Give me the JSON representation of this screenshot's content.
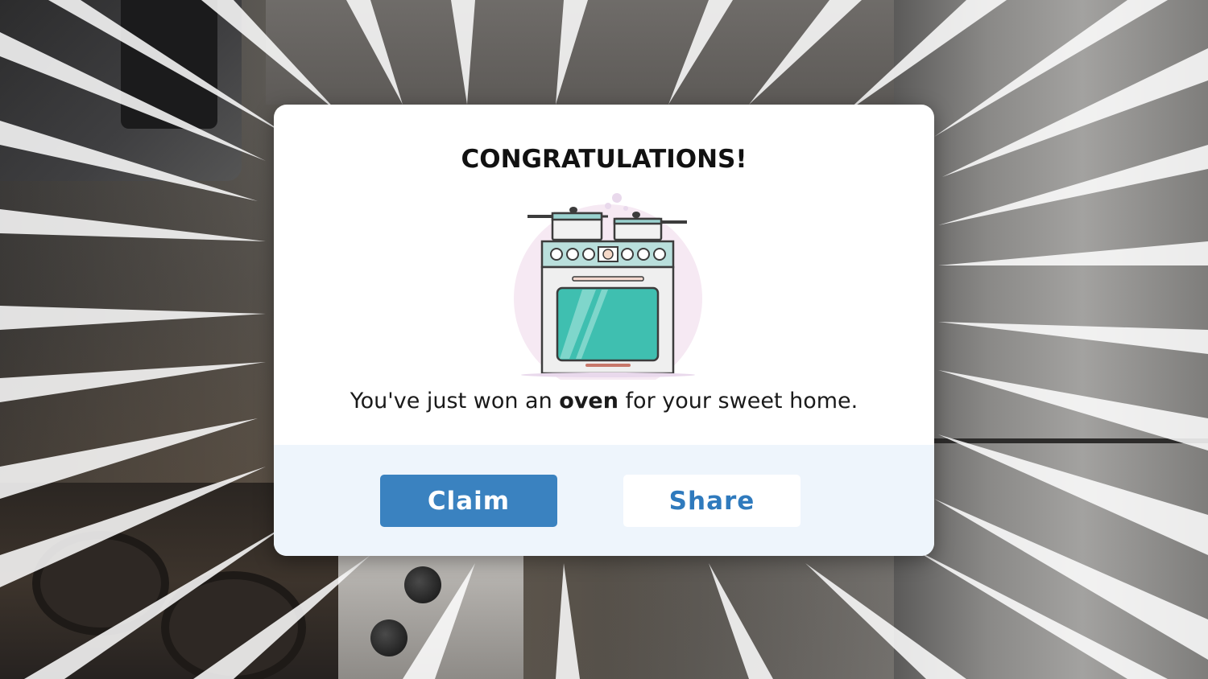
{
  "dialog": {
    "title": "CONGRATULATIONS!",
    "message_prefix": "You've just won an ",
    "message_bold": "oven",
    "message_suffix": " for your sweet home.",
    "illustration_icon": "oven-icon"
  },
  "actions": {
    "claim_label": "Claim",
    "share_label": "Share"
  },
  "colors": {
    "claim_button": "#3a82c0",
    "share_text": "#2f7abd",
    "footer_background": "#eef5fc",
    "oven_window": "#3fbfb0"
  }
}
